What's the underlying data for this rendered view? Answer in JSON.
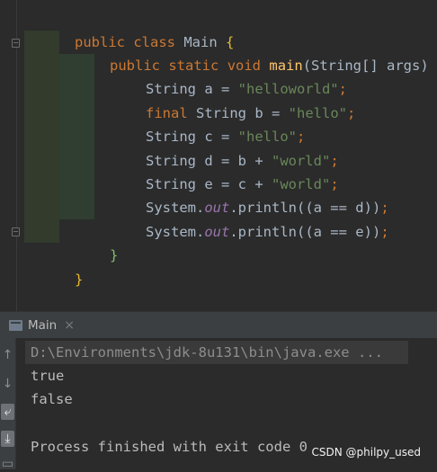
{
  "editor": {
    "lines": [
      [
        "public",
        " ",
        "class",
        " Main ",
        "{"
      ],
      [
        "public",
        " ",
        "static",
        " ",
        "void",
        " ",
        "main",
        "(String[] args) ",
        "{"
      ],
      [
        "String a = ",
        "\"helloworld\"",
        ";"
      ],
      [
        "final",
        " String b = ",
        "\"hello\"",
        ";"
      ],
      [
        "String c = ",
        "\"hello\"",
        ";"
      ],
      [
        "String d = b + ",
        "\"world\"",
        ";"
      ],
      [
        "String e = c + ",
        "\"world\"",
        ";"
      ],
      [
        "System.",
        "out",
        ".println((a == d))",
        ";"
      ],
      [
        "System.",
        "out",
        ".println((a == e))",
        ";"
      ],
      [
        "}"
      ],
      [
        "}"
      ]
    ]
  },
  "run_panel": {
    "tab_label": "Main",
    "close_glyph": "×"
  },
  "console": {
    "command": "D:\\Environments\\jdk-8u131\\bin\\java.exe ...",
    "output_1": "true",
    "output_2": "false",
    "exit_message": "Process finished with exit code 0"
  },
  "watermark": "CSDN @philpy_used"
}
